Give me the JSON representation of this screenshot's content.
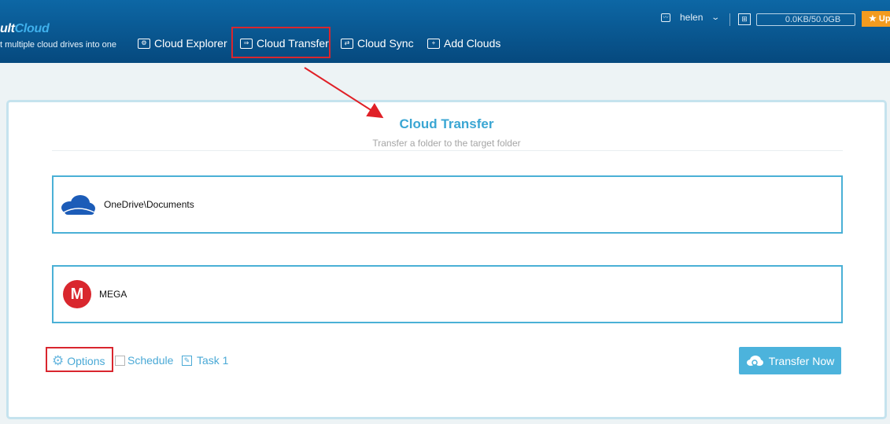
{
  "header": {
    "logo_prefix": "ult",
    "logo_suffix": "Cloud",
    "tagline": "t multiple cloud drives into one",
    "nav": [
      {
        "label": "Cloud Explorer",
        "icon": "cloud-explorer-icon"
      },
      {
        "label": "Cloud Transfer",
        "icon": "cloud-transfer-icon"
      },
      {
        "label": "Cloud Sync",
        "icon": "cloud-sync-icon"
      },
      {
        "label": "Add Clouds",
        "icon": "add-clouds-icon"
      }
    ],
    "user": "helen",
    "storage": "0.0KB/50.0GB",
    "upgrade": "★ Up"
  },
  "panel": {
    "title": "Cloud Transfer",
    "subtitle": "Transfer a folder to the target folder",
    "source": {
      "label": "OneDrive\\Documents",
      "icon": "onedrive-icon"
    },
    "target": {
      "label": "MEGA",
      "icon": "mega-icon"
    },
    "options_label": "Options",
    "schedule_label": "Schedule",
    "task_label": "Task 1",
    "transfer_button": "Transfer Now"
  },
  "colors": {
    "header_top": "#0d67a5",
    "header_bottom": "#06497e",
    "accent": "#4cb3dc",
    "highlight": "#d9262e",
    "mega_red": "#d9272e",
    "onedrive_blue": "#1c5cb8",
    "upgrade_orange": "#f39b1f"
  }
}
